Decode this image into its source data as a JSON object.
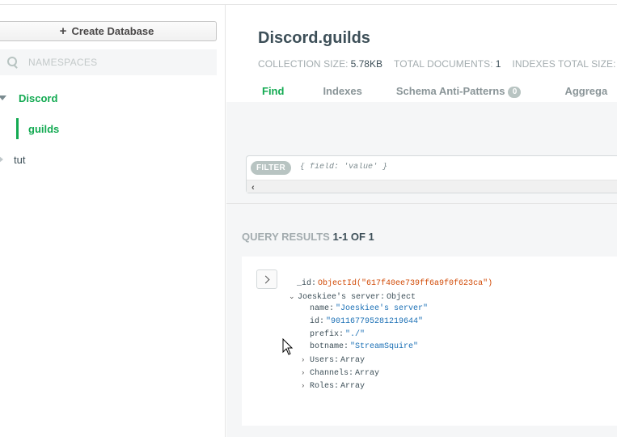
{
  "sidebar": {
    "create_database_label": "Create Database",
    "search_placeholder": "NAMESPACES",
    "databases": [
      {
        "name": "Discord",
        "expanded": true,
        "collections": [
          "guilds"
        ]
      },
      {
        "name": "tut",
        "expanded": false
      }
    ]
  },
  "header": {
    "title": "Discord.guilds",
    "stats": [
      {
        "label": "COLLECTION SIZE:",
        "value": "5.78KB"
      },
      {
        "label": "TOTAL DOCUMENTS:",
        "value": "1"
      },
      {
        "label": "INDEXES TOTAL SIZE:",
        "value": ""
      }
    ],
    "tabs": [
      {
        "label": "Find",
        "active": true
      },
      {
        "label": "Indexes"
      },
      {
        "label": "Schema Anti-Patterns",
        "badge": "0"
      },
      {
        "label": "Aggrega"
      }
    ]
  },
  "filter": {
    "pill": "FILTER",
    "placeholder": "{ field: 'value' }"
  },
  "results": {
    "label": "QUERY RESULTS",
    "count": "1-1 OF 1"
  },
  "document": {
    "id_key": "_id",
    "id_value": "ObjectId(\"617f40ee739ff6a9f0f623ca\")",
    "server_key": "Joeskiee's server",
    "server_type": "Object",
    "fields": [
      {
        "key": "name",
        "value": "\"Joeskiee's server\""
      },
      {
        "key": "id",
        "value": "\"901167795281219644\""
      },
      {
        "key": "prefix",
        "value": "\"./\""
      },
      {
        "key": "botname",
        "value": "\"StreamSquire\""
      }
    ],
    "arrays": [
      {
        "key": "Users",
        "type": "Array"
      },
      {
        "key": "Channels",
        "type": "Array"
      },
      {
        "key": "Roles",
        "type": "Array"
      }
    ]
  },
  "colors": {
    "accent_green": "#13aa52",
    "objectid_orange": "#d14a06",
    "string_blue": "#1a6fb5"
  }
}
